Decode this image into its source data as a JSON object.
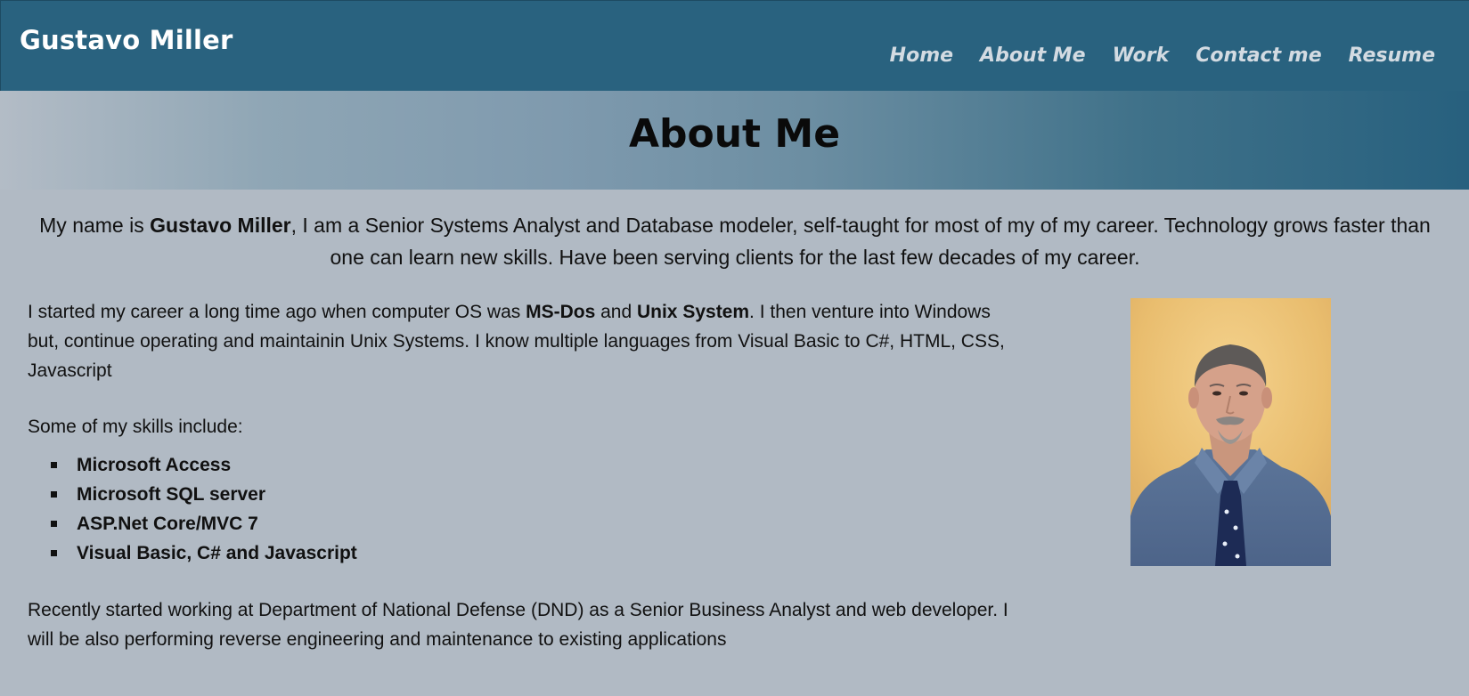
{
  "header": {
    "brand": "Gustavo Miller",
    "nav": [
      "Home",
      "About Me",
      "Work",
      "Contact me",
      "Resume"
    ]
  },
  "banner": {
    "title": "About Me"
  },
  "intro": {
    "prefix": "My name is ",
    "name": "Gustavo Miller",
    "suffix": ", I am a Senior Systems Analyst and Database modeler, self-taught for most of my of my career. Technology grows faster than one can learn new skills. Have been serving clients for the last few decades of my career."
  },
  "career": {
    "part1": "I started my career a long time ago when computer OS was ",
    "bold1": "MS-Dos",
    "part2": " and ",
    "bold2": "Unix System",
    "part3": ". I then venture into Windows but, continue operating and maintainin Unix Systems. I know multiple languages from Visual Basic to C#, HTML, CSS, Javascript"
  },
  "skills": {
    "heading": "Some of my skills include:",
    "items": [
      "Microsoft Access",
      "Microsoft SQL server",
      "ASP.Net Core/MVC 7",
      "Visual Basic, C# and Javascript"
    ]
  },
  "recent": {
    "text": "Recently started working at Department of National Defense (DND) as a Senior Business Analyst and web developer. I will be also performing reverse engineering and maintenance to existing applications"
  },
  "colors": {
    "header_bg": "#29627f",
    "page_bg": "#b1bac4",
    "nav_text": "#d3dbe2"
  }
}
